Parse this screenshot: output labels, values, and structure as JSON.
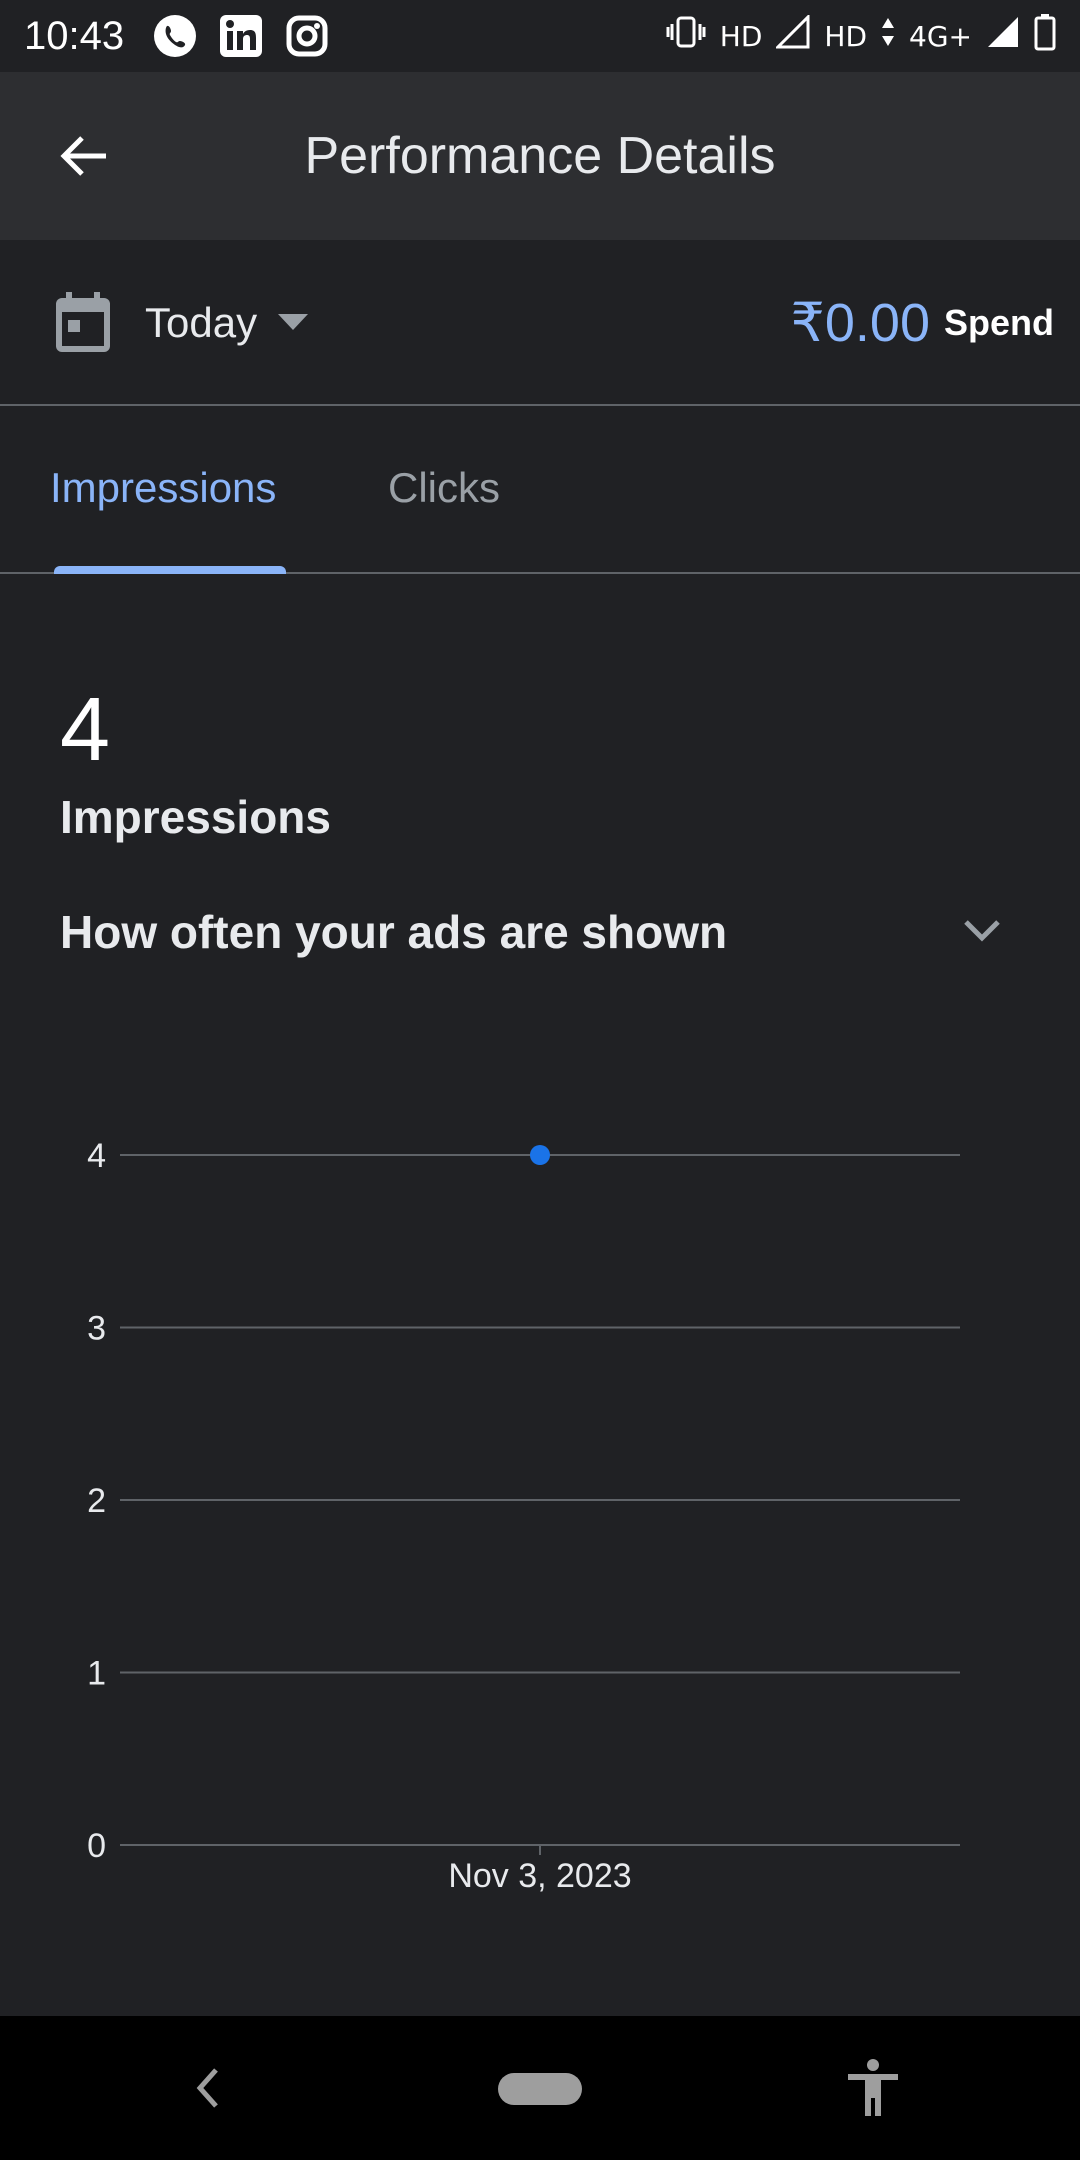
{
  "status_bar": {
    "time": "10:43",
    "app_icons": [
      "phone-icon",
      "linkedin-icon",
      "instagram-icon"
    ],
    "network_labels": [
      "HD",
      "HD",
      "4G+"
    ]
  },
  "app_bar": {
    "title": "Performance Details",
    "back_icon": "arrow-back-icon"
  },
  "date_range": {
    "label": "Today",
    "spend_value": "₹0.00",
    "spend_label": "Spend"
  },
  "tabs": [
    {
      "label": "Impressions",
      "selected": true
    },
    {
      "label": "Clicks",
      "selected": false
    }
  ],
  "metric": {
    "value": "4",
    "label": "Impressions"
  },
  "section": {
    "title": "How often your ads are shown"
  },
  "colors": {
    "accent": "#8ab4f8",
    "point": "#1a73e8",
    "background": "#202124",
    "app_bar": "#2d2e31"
  },
  "chart_data": {
    "type": "scatter",
    "categories": [
      "Nov 3, 2023"
    ],
    "series": [
      {
        "values": [
          4
        ]
      }
    ],
    "y_ticks": [
      "0",
      "1",
      "2",
      "3",
      "4"
    ],
    "ylim": [
      0,
      4
    ],
    "grid": true,
    "title": "",
    "xlabel": "",
    "ylabel": ""
  }
}
